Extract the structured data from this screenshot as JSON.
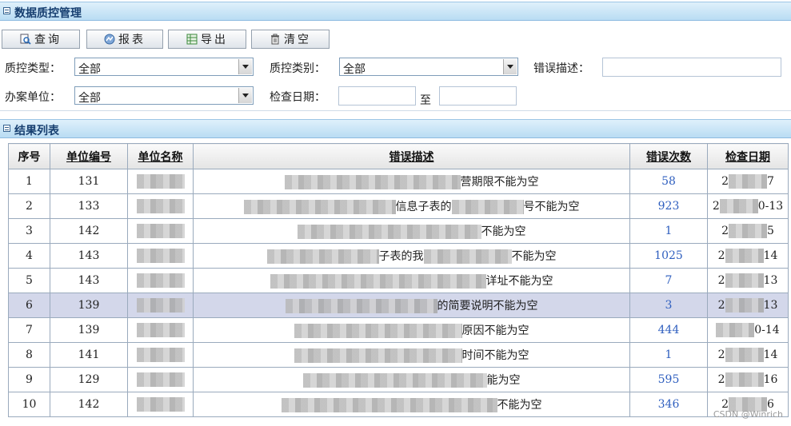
{
  "panel_title": "数据质控管理",
  "toolbar": {
    "query": "查询",
    "report": "报表",
    "export": "导出",
    "clear": "清空"
  },
  "filters": {
    "qc_type_label": "质控类型：",
    "qc_type_value": "全部",
    "qc_category_label": "质控类别：",
    "qc_category_value": "全部",
    "error_desc_label": "错误描述：",
    "error_desc_value": "",
    "unit_label": "办案单位：",
    "unit_value": "全部",
    "check_date_label": "检查日期：",
    "date_from": "",
    "date_to_label": "至",
    "date_to": ""
  },
  "results_title": "结果列表",
  "table": {
    "headers": [
      "序号",
      "单位编号",
      "单位名称",
      "错误描述",
      "错误次数",
      "检查日期"
    ],
    "rows": [
      {
        "no": "1",
        "unit_code": "131",
        "desc_suffix": "营期限不能为空",
        "count": "58",
        "date_prefix": "2",
        "date_suffix": "7"
      },
      {
        "no": "2",
        "unit_code": "133",
        "desc_suffix": "信息子表的",
        "desc_suffix2": "号不能为空",
        "count": "923",
        "date_prefix": "2",
        "date_suffix": "0-13"
      },
      {
        "no": "3",
        "unit_code": "142",
        "desc_suffix": "不能为空",
        "count": "1",
        "date_prefix": "2",
        "date_suffix": "5"
      },
      {
        "no": "4",
        "unit_code": "143",
        "desc_suffix": "子表的我",
        "desc_suffix2": "不能为空",
        "count": "1025",
        "date_prefix": "2",
        "date_suffix": "14"
      },
      {
        "no": "5",
        "unit_code": "143",
        "desc_suffix": "详址不能为空",
        "count": "7",
        "date_prefix": "2",
        "date_suffix": "13"
      },
      {
        "no": "6",
        "unit_code": "139",
        "desc_suffix": "的简要说明不能为空",
        "count": "3",
        "date_prefix": "2",
        "date_suffix": "13"
      },
      {
        "no": "7",
        "unit_code": "139",
        "desc_suffix": "原因不能为空",
        "count": "444",
        "date_prefix": "",
        "date_suffix": "0-14"
      },
      {
        "no": "8",
        "unit_code": "141",
        "desc_suffix": "时间不能为空",
        "count": "1",
        "date_prefix": "2",
        "date_suffix": "14"
      },
      {
        "no": "9",
        "unit_code": "129",
        "desc_suffix": "能为空",
        "count": "595",
        "date_prefix": "2",
        "date_suffix": "16"
      },
      {
        "no": "10",
        "unit_code": "142",
        "desc_suffix": "不能为空",
        "count": "346",
        "date_prefix": "2",
        "date_suffix": "6"
      }
    ],
    "selected_row": 6
  },
  "watermark": "CSDN @Winrich"
}
